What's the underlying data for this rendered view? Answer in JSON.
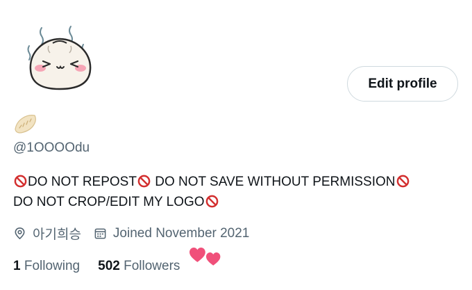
{
  "profile": {
    "avatar_icon": "steamed-bun-avatar-icon",
    "name_icon": "dumpling-emoji-icon",
    "handle": "@1OOOOdu",
    "bio": {
      "line1_a": "DO NOT REPOST",
      "line1_b": " DO NOT SAVE WITHOUT PERMISSION",
      "line2": "DO NOT CROP/EDIT MY LOGO"
    },
    "location": "아기희승",
    "joined": "Joined November 2021"
  },
  "actions": {
    "edit_profile_label": "Edit profile"
  },
  "stats": {
    "following_count": "1",
    "following_label": "Following",
    "followers_count": "502",
    "followers_label": "Followers"
  },
  "colors": {
    "text": "#0f1419",
    "secondary": "#536471",
    "border": "#cfd9de",
    "prohibited": "#d32f2f",
    "heart": "#f0507a"
  }
}
